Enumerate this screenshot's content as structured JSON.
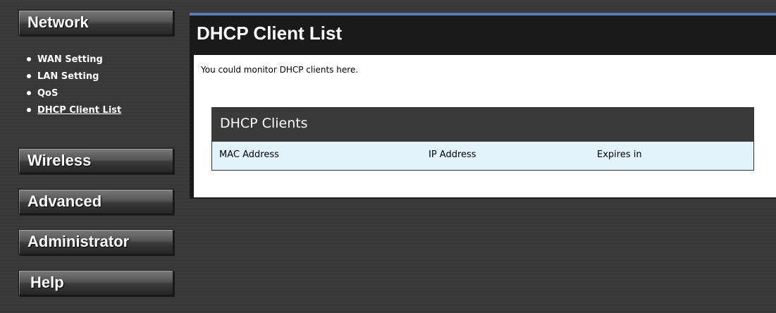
{
  "sidebar": {
    "network_label": "Network",
    "sub_items": [
      {
        "label": "WAN Setting"
      },
      {
        "label": "LAN Setting"
      },
      {
        "label": "QoS"
      },
      {
        "label": "DHCP Client List"
      }
    ],
    "wireless_label": "Wireless",
    "advanced_label": "Advanced",
    "administrator_label": "Administrator",
    "help_label": "Help"
  },
  "main": {
    "title": "DHCP Client List",
    "description": "You could monitor DHCP clients here.",
    "table": {
      "title": "DHCP Clients",
      "columns": [
        "MAC Address",
        "IP Address",
        "Expires in"
      ],
      "rows": []
    }
  },
  "colors": {
    "panel_accent": "#5b7bbd",
    "column_header_bg": "#e3f3fb",
    "table_header_bg": "#3a3a3a"
  }
}
